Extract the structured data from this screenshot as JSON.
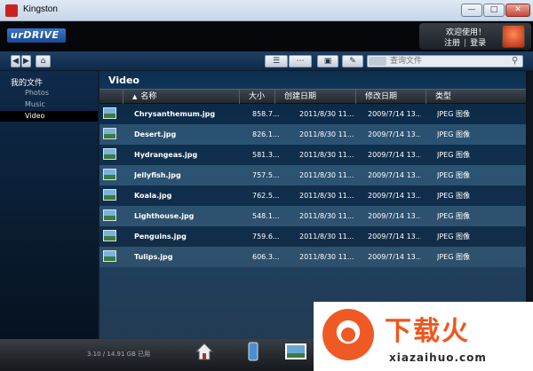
{
  "window": {
    "title": "Kingston",
    "min_icon": "minimize-icon",
    "max_icon": "maximize-icon",
    "close_icon": "close-icon"
  },
  "header": {
    "logo_text": "urDRIVE",
    "welcome": "欢迎使用！",
    "register": "注册",
    "separator": "|",
    "login": "登录"
  },
  "toolbar": {
    "search_placeholder": "查询文件",
    "icons": [
      "back-icon",
      "forward-icon",
      "home-icon",
      "list-view-icon",
      "grid-view-icon",
      "new-folder-icon",
      "rename-icon",
      "search-icon"
    ]
  },
  "sidebar": {
    "root": "我的文件",
    "items": [
      {
        "label": "Photos",
        "active": false
      },
      {
        "label": "Music",
        "active": false
      },
      {
        "label": "Video",
        "active": true
      }
    ]
  },
  "main": {
    "folder_title": "Video",
    "columns": {
      "name": "名称",
      "size": "大小",
      "created": "创建日期",
      "modified": "修改日期",
      "type": "类型"
    },
    "rows": [
      {
        "name": "Chrysanthemum.jpg",
        "size": "858.7...",
        "created": "2011/8/30   11...",
        "modified": "2009/7/14   13...",
        "type": "JPEG 图像"
      },
      {
        "name": "Desert.jpg",
        "size": "826.1...",
        "created": "2011/8/30   11...",
        "modified": "2009/7/14   13...",
        "type": "JPEG 图像"
      },
      {
        "name": "Hydrangeas.jpg",
        "size": "581.3...",
        "created": "2011/8/30   11...",
        "modified": "2009/7/14   13...",
        "type": "JPEG 图像"
      },
      {
        "name": "Jellyfish.jpg",
        "size": "757.5...",
        "created": "2011/8/30   11...",
        "modified": "2009/7/14   13...",
        "type": "JPEG 图像"
      },
      {
        "name": "Koala.jpg",
        "size": "762.5...",
        "created": "2011/8/30   11...",
        "modified": "2009/7/14   13...",
        "type": "JPEG 图像"
      },
      {
        "name": "Lighthouse.jpg",
        "size": "548.1...",
        "created": "2011/8/30   11...",
        "modified": "2009/7/14   13...",
        "type": "JPEG 图像"
      },
      {
        "name": "Penguins.jpg",
        "size": "759.6...",
        "created": "2011/8/30   11...",
        "modified": "2009/7/14   13...",
        "type": "JPEG 图像"
      },
      {
        "name": "Tulips.jpg",
        "size": "606.3...",
        "created": "2011/8/30   11...",
        "modified": "2009/7/14   13...",
        "type": "JPEG 图像"
      }
    ]
  },
  "footer": {
    "capacity": "3.10 / 14.91 GB 已用",
    "dock": [
      "home-icon",
      "phone-icon",
      "photo-icon"
    ]
  },
  "watermark": {
    "cn": "下载火",
    "en": "xiazaihuo.com",
    "icon": "download-badge-icon"
  },
  "colors": {
    "header_bg": "#05070a",
    "toolbar_bg": "#1f3f63",
    "row_dark": "#0a233c",
    "row_light": "#3c5f78",
    "accent_orange": "#f0561d"
  }
}
